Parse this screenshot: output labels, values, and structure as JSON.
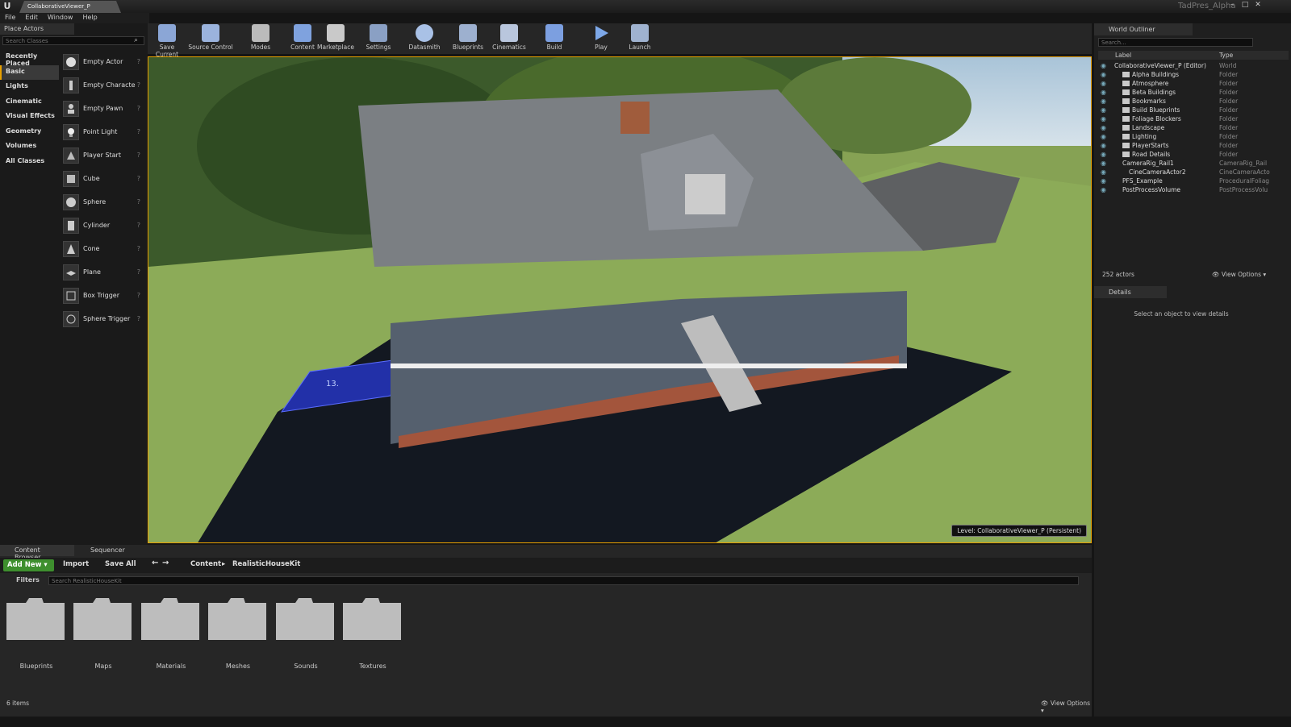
{
  "window": {
    "tab_title": "CollaborativeViewer_P",
    "project": "TadPres_Alpha"
  },
  "menu": [
    "File",
    "Edit",
    "Window",
    "Help"
  ],
  "place_actors": {
    "tab": "Place Actors",
    "search_placeholder": "Search Classes",
    "categories": [
      "Recently Placed",
      "Basic",
      "Lights",
      "Cinematic",
      "Visual Effects",
      "Geometry",
      "Volumes",
      "All Classes"
    ],
    "selected_category": "Basic",
    "actors": [
      "Empty Actor",
      "Empty Characte",
      "Empty Pawn",
      "Point Light",
      "Player Start",
      "Cube",
      "Sphere",
      "Cylinder",
      "Cone",
      "Plane",
      "Box Trigger",
      "Sphere Trigger"
    ]
  },
  "toolbar": [
    "Save Current",
    "Source Control",
    "Modes",
    "Content",
    "Marketplace",
    "Settings",
    "Datasmith",
    "Blueprints",
    "Cinematics",
    "Build",
    "Play",
    "Launch"
  ],
  "viewport": {
    "level": "Level:  CollaborativeViewer_P (Persistent)",
    "decal_text": "13."
  },
  "outliner": {
    "tab": "World Outliner",
    "search_placeholder": "Search...",
    "col_label": "Label",
    "col_type": "Type",
    "rows": [
      {
        "label": "CollaborativeViewer_P (Editor)",
        "type": "World"
      },
      {
        "label": "Alpha Buildings",
        "type": "Folder"
      },
      {
        "label": "Atmosphere",
        "type": "Folder"
      },
      {
        "label": "Beta Buildings",
        "type": "Folder"
      },
      {
        "label": "Bookmarks",
        "type": "Folder"
      },
      {
        "label": "Build Blueprints",
        "type": "Folder"
      },
      {
        "label": "Foliage Blockers",
        "type": "Folder"
      },
      {
        "label": "Landscape",
        "type": "Folder"
      },
      {
        "label": "Lighting",
        "type": "Folder"
      },
      {
        "label": "PlayerStarts",
        "type": "Folder"
      },
      {
        "label": "Road Details",
        "type": "Folder"
      },
      {
        "label": "CameraRig_Rail1",
        "type": "CameraRig_Rail"
      },
      {
        "label": "CineCameraActor2",
        "type": "CineCameraActo"
      },
      {
        "label": "PFS_Example",
        "type": "ProceduralFoliag"
      },
      {
        "label": "PostProcessVolume",
        "type": "PostProcessVolu"
      }
    ],
    "actor_count": "252 actors",
    "view_options": "View Options"
  },
  "details": {
    "tab": "Details",
    "message": "Select an object to view details"
  },
  "content_browser": {
    "tab": "Content Browser",
    "tab2": "Sequencer",
    "add_new": "Add New",
    "import": "Import",
    "save_all": "Save All",
    "path": [
      "Content",
      "RealisticHouseKit"
    ],
    "filters": "Filters",
    "search_placeholder": "Search RealisticHouseKit",
    "folders": [
      "Blueprints",
      "Maps",
      "Materials",
      "Meshes",
      "Sounds",
      "Textures"
    ],
    "item_count": "6 items",
    "view_options": "View Options"
  },
  "colors": {
    "accent": "#e8a000",
    "add_new": "#3e8f2e",
    "panel": "#262626",
    "dark": "#1a1a1a"
  }
}
